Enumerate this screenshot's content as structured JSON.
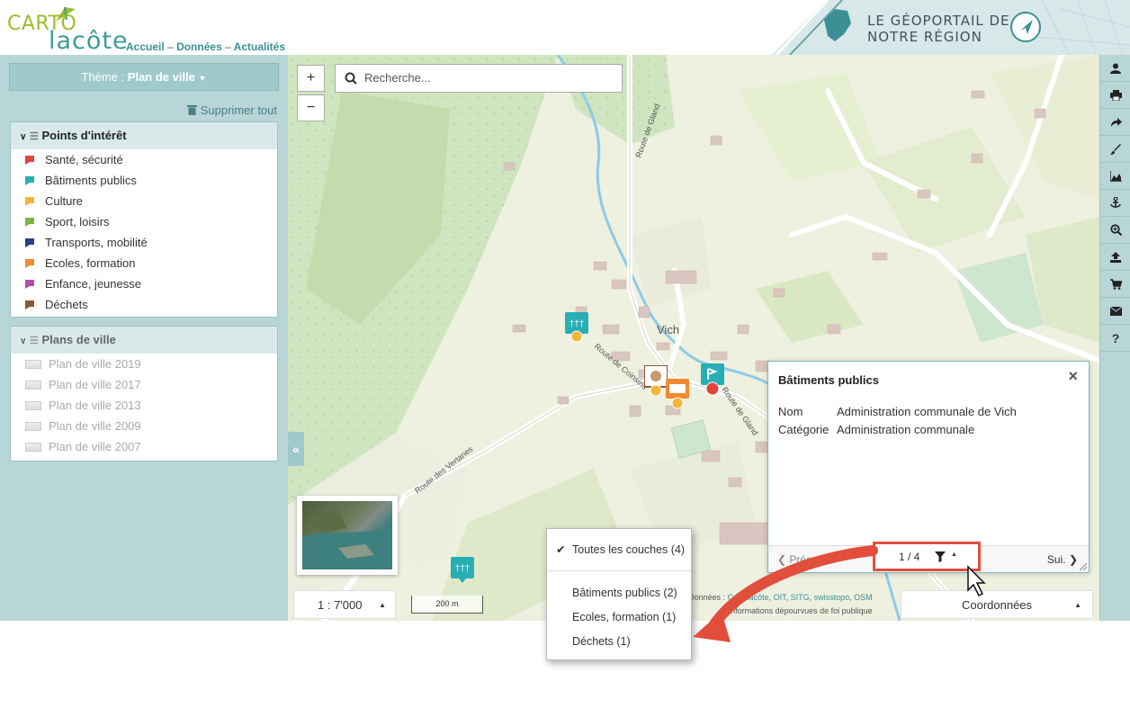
{
  "header": {
    "logo_top": "CARTO",
    "logo_bottom": "lacôte",
    "nav": [
      "Accueil",
      "Données",
      "Actualités"
    ],
    "nav_sep": "–",
    "portal_line1": "LE GÉOPORTAIL DE",
    "portal_line2": "NOTRE RÉGION"
  },
  "sidebar": {
    "theme_prefix": "Thème : ",
    "theme_value": "Plan de ville",
    "delete_all": "Supprimer tout",
    "poi_group": {
      "title": "Points d'intérêt",
      "items": [
        {
          "label": "Santé, sécurité",
          "color": "#e0443c"
        },
        {
          "label": "Bâtiments publics",
          "color": "#2aaeb5"
        },
        {
          "label": "Culture",
          "color": "#f2b63a"
        },
        {
          "label": "Sport, loisirs",
          "color": "#7ab648"
        },
        {
          "label": "Transports, mobilité",
          "color": "#2b3f8a"
        },
        {
          "label": "Ecoles, formation",
          "color": "#f08a2e"
        },
        {
          "label": "Enfance, jeunesse",
          "color": "#b04eb0"
        },
        {
          "label": "Déchets",
          "color": "#8a5a3a"
        }
      ]
    },
    "plans_group": {
      "title": "Plans de ville",
      "items": [
        "Plan de ville 2019",
        "Plan de ville 2017",
        "Plan de ville 2013",
        "Plan de ville 2009",
        "Plan de ville 2007"
      ]
    },
    "collapse_glyph": "«"
  },
  "map": {
    "zoom_in": "+",
    "zoom_out": "−",
    "search_placeholder": "Recherche...",
    "village_label": "Vich",
    "roads": [
      "Route de Gland",
      "Route de Coinsins",
      "Route de Gland",
      "Route des Vertanes"
    ],
    "scale_value": "1 : 7'000",
    "scale_bar": "200 m",
    "attribution_prefix": "Données : ",
    "attribution_links": [
      "Cartolacôte",
      "OIT",
      "SITG",
      "swisstopo",
      "OSM"
    ],
    "attribution_line2": "Informations dépourvues de foi publique",
    "coords_label": "Coordonnées"
  },
  "popup": {
    "title": "Bâtiments publics",
    "close": "×",
    "fields": [
      {
        "label": "Nom",
        "value": "Administration communale de Vich"
      },
      {
        "label": "Catégorie",
        "value": "Administration communale"
      }
    ],
    "prev": "Préc.",
    "next": "Sui.",
    "pager": "1 / 4"
  },
  "dropdown": {
    "all_layers": "Toutes les couches (4)",
    "items": [
      "Bâtiments publics (2)",
      "Ecoles, formation (1)",
      "Déchets (1)"
    ]
  },
  "toolbar_icons": [
    "user-icon",
    "print-icon",
    "share-icon",
    "draw-icon",
    "profile-chart-icon",
    "anchor-icon",
    "zoom-search-icon",
    "upload-icon",
    "cart-icon",
    "mail-icon",
    "help-icon"
  ],
  "colors": {
    "accent": "#3b8f95",
    "panel_bg": "#b8d5d7",
    "highlight_red": "#e14e3c"
  }
}
